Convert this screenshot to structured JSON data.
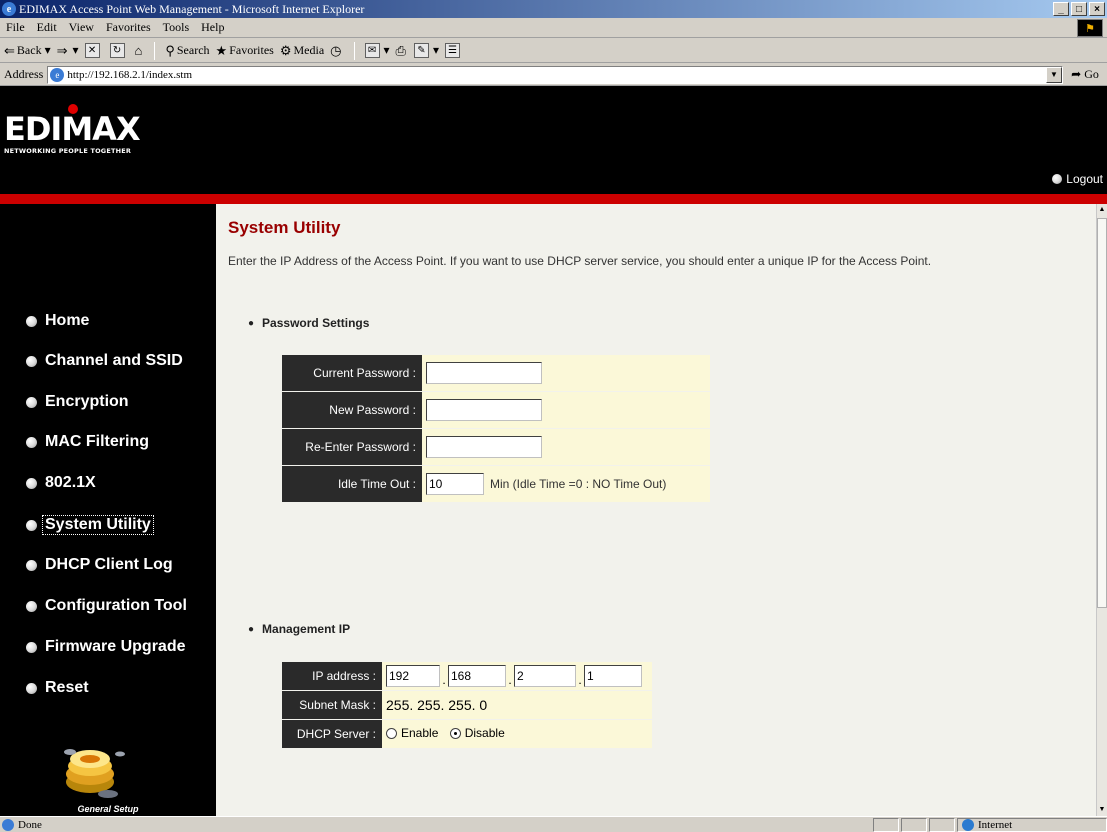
{
  "window": {
    "title": "EDIMAX Access Point Web Management - Microsoft Internet Explorer",
    "min": "_",
    "max": "□",
    "close": "×"
  },
  "menu": [
    "File",
    "Edit",
    "View",
    "Favorites",
    "Tools",
    "Help"
  ],
  "toolbar": {
    "back": "Back",
    "search": "Search",
    "favorites": "Favorites",
    "media": "Media"
  },
  "address": {
    "label": "Address",
    "url": "http://192.168.2.1/index.stm",
    "go": "Go"
  },
  "brand": {
    "logo_text": "EDIMAX",
    "tagline": "NETWORKING PEOPLE TOGETHER",
    "logout": "Logout"
  },
  "nav": [
    {
      "label": "Home"
    },
    {
      "label": "Channel and SSID"
    },
    {
      "label": "Encryption"
    },
    {
      "label": "MAC Filtering"
    },
    {
      "label": "802.1X"
    },
    {
      "label": "System Utility",
      "active": true
    },
    {
      "label": "DHCP Client Log"
    },
    {
      "label": "Configuration Tool"
    },
    {
      "label": "Firmware Upgrade"
    },
    {
      "label": "Reset"
    }
  ],
  "sidebar_footer": "General Setup",
  "page": {
    "title": "System Utility",
    "description": "Enter the IP Address of the Access Point. If you want to use DHCP server service, you should enter a unique IP for the Access Point."
  },
  "password": {
    "section_title": "Password Settings",
    "current_label": "Current Password :",
    "current_value": "",
    "new_label": "New Password :",
    "new_value": "",
    "reenter_label": "Re-Enter Password :",
    "reenter_value": "",
    "idle_label": "Idle Time Out :",
    "idle_value": "10",
    "idle_hint": "Min  (Idle Time =0 : NO Time Out)"
  },
  "management": {
    "section_title": "Management IP",
    "ip_label": "IP address :",
    "ip": [
      "192",
      "168",
      "2",
      "1"
    ],
    "ip_sep": ".",
    "mask_label": "Subnet Mask :",
    "mask_value": "255. 255. 255. 0",
    "dhcp_label": "DHCP Server :",
    "dhcp_enable": "Enable",
    "dhcp_disable": "Disable",
    "dhcp_selected": "Disable"
  },
  "status": {
    "text": "Done",
    "zone": "Internet"
  }
}
